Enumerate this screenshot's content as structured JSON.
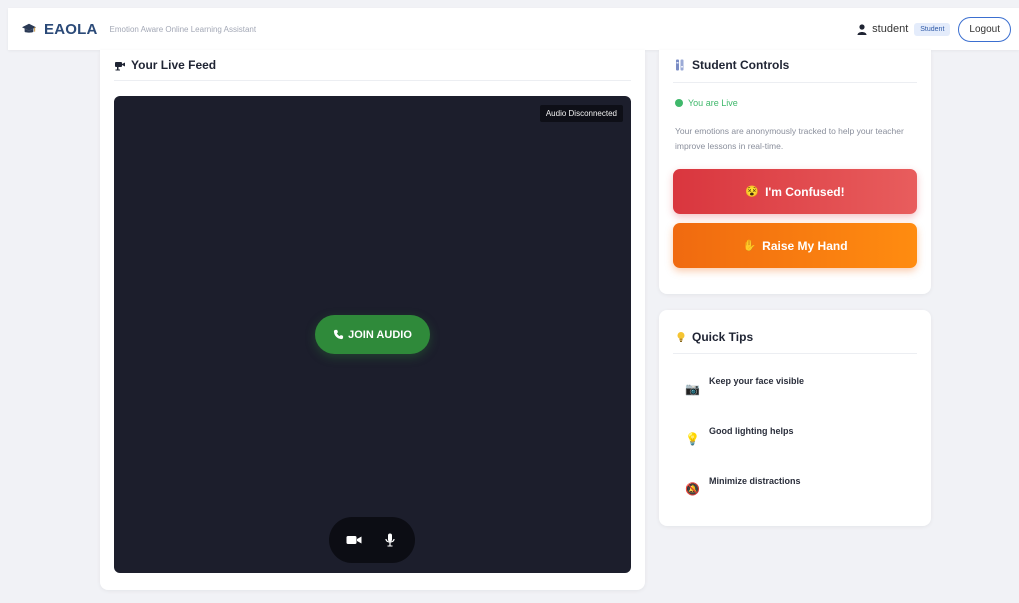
{
  "header": {
    "brand_name": "EAOLA",
    "brand_subtitle": "Emotion Aware Online Learning Assistant",
    "user_name": "student",
    "role_badge": "Student",
    "logout_label": "Logout"
  },
  "feed": {
    "title": "Your Live Feed",
    "audio_status": "Audio Disconnected",
    "join_audio_label": "JOIN AUDIO"
  },
  "controls": {
    "title": "Student Controls",
    "live_status": "You are Live",
    "tracking_note": "Your emotions are anonymously tracked to help your teacher improve lessons in real-time.",
    "confused_label": "I'm Confused!",
    "confused_emoji": "😵",
    "raise_hand_label": "Raise My Hand",
    "raise_hand_emoji": "✋"
  },
  "tips": {
    "title": "Quick Tips",
    "items": [
      {
        "icon": "📷",
        "text": "Keep your face visible"
      },
      {
        "icon": "💡",
        "text": "Good lighting helps"
      },
      {
        "icon": "🔕",
        "text": "Minimize distractions"
      }
    ]
  },
  "colors": {
    "brand": "#2b4a78",
    "live_green": "#3fb86b",
    "join_green": "#2f8a3a",
    "confused_red": "#d9363e",
    "raise_orange": "#f06a10",
    "video_bg": "#1c1e2c"
  },
  "icons": {
    "brand": "graduation-cap-icon",
    "user": "user-icon",
    "feed": "camera-icon",
    "controls": "controls-icon",
    "tips": "lightbulb-icon",
    "join": "phone-icon",
    "video": "video-camera-icon",
    "mic": "microphone-icon"
  }
}
